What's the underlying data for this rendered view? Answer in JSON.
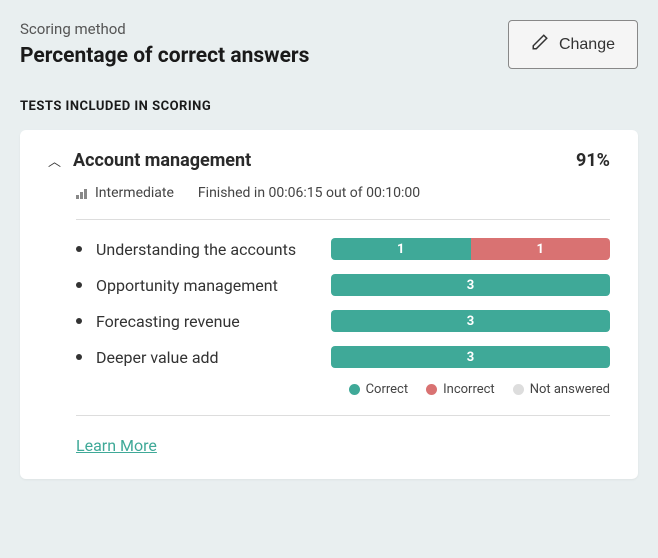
{
  "header": {
    "scoring_label": "Scoring method",
    "scoring_value": "Percentage of correct answers",
    "change_label": "Change"
  },
  "section": {
    "label": "TESTS INCLUDED IN SCORING"
  },
  "test": {
    "title": "Account management",
    "score": "91%",
    "level": "Intermediate",
    "timing": "Finished in 00:06:15 out of 00:10:00",
    "learn_more": "Learn More"
  },
  "skills": [
    {
      "name": "Understanding the accounts",
      "correct": 1,
      "incorrect": 1,
      "na": 0
    },
    {
      "name": "Opportunity management",
      "correct": 3,
      "incorrect": 0,
      "na": 0
    },
    {
      "name": "Forecasting revenue",
      "correct": 3,
      "incorrect": 0,
      "na": 0
    },
    {
      "name": "Deeper value add",
      "correct": 3,
      "incorrect": 0,
      "na": 0
    }
  ],
  "legend": {
    "correct": "Correct",
    "incorrect": "Incorrect",
    "na": "Not answered"
  },
  "chart_data": {
    "type": "bar",
    "title": "Account management",
    "categories": [
      "Understanding the accounts",
      "Opportunity management",
      "Forecasting revenue",
      "Deeper value add"
    ],
    "series": [
      {
        "name": "Correct",
        "values": [
          1,
          3,
          3,
          3
        ]
      },
      {
        "name": "Incorrect",
        "values": [
          1,
          0,
          0,
          0
        ]
      },
      {
        "name": "Not answered",
        "values": [
          0,
          0,
          0,
          0
        ]
      }
    ]
  }
}
